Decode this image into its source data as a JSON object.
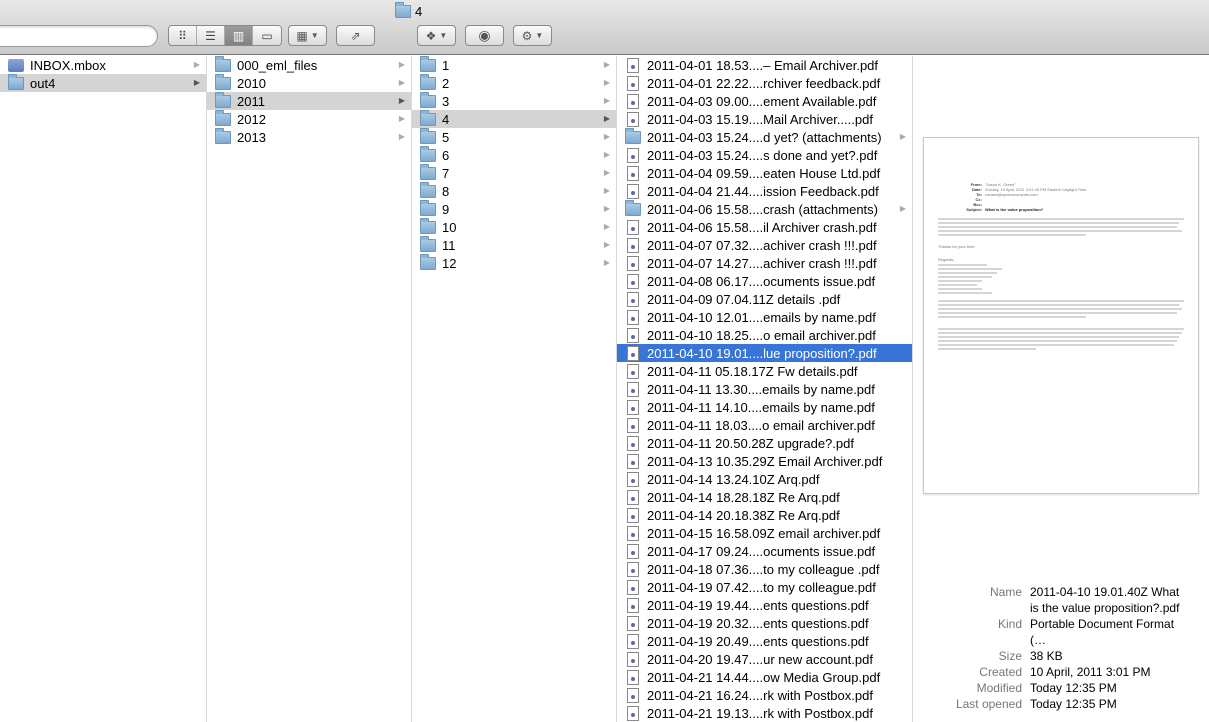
{
  "window": {
    "title": "4"
  },
  "toolbar": {
    "search_placeholder": "",
    "view_modes": [
      {
        "name": "icon-view",
        "glyph": "⠿"
      },
      {
        "name": "list-view",
        "glyph": "☰"
      },
      {
        "name": "column-view",
        "glyph": "▥"
      },
      {
        "name": "coverflow-view",
        "glyph": "▭"
      }
    ],
    "active_view": "column-view"
  },
  "columns": [
    {
      "items": [
        {
          "label": "INBOX.mbox",
          "kind": "mbox"
        },
        {
          "label": "out4",
          "kind": "folder",
          "selected": true
        }
      ]
    },
    {
      "items": [
        {
          "label": "000_eml_files",
          "kind": "folder"
        },
        {
          "label": "2010",
          "kind": "folder"
        },
        {
          "label": "2011",
          "kind": "folder",
          "selected": true
        },
        {
          "label": "2012",
          "kind": "folder"
        },
        {
          "label": "2013",
          "kind": "folder"
        }
      ]
    },
    {
      "items": [
        {
          "label": "1",
          "kind": "folder"
        },
        {
          "label": "2",
          "kind": "folder"
        },
        {
          "label": "3",
          "kind": "folder"
        },
        {
          "label": "4",
          "kind": "folder",
          "selected": true
        },
        {
          "label": "5",
          "kind": "folder"
        },
        {
          "label": "6",
          "kind": "folder"
        },
        {
          "label": "7",
          "kind": "folder"
        },
        {
          "label": "8",
          "kind": "folder"
        },
        {
          "label": "9",
          "kind": "folder"
        },
        {
          "label": "10",
          "kind": "folder"
        },
        {
          "label": "11",
          "kind": "folder"
        },
        {
          "label": "12",
          "kind": "folder"
        }
      ]
    },
    {
      "items": [
        {
          "label": "2011-04-01 18.53....– Email Archiver.pdf",
          "kind": "pdf"
        },
        {
          "label": "2011-04-01 22.22....rchiver feedback.pdf",
          "kind": "pdf"
        },
        {
          "label": "2011-04-03 09.00....ement Available.pdf",
          "kind": "pdf"
        },
        {
          "label": "2011-04-03 15.19....Mail Archiver.....pdf",
          "kind": "pdf"
        },
        {
          "label": "2011-04-03 15.24....d yet? (attachments)",
          "kind": "folder"
        },
        {
          "label": "2011-04-03 15.24....s done and yet?.pdf",
          "kind": "pdf"
        },
        {
          "label": "2011-04-04 09.59....eaten House Ltd.pdf",
          "kind": "pdf"
        },
        {
          "label": "2011-04-04 21.44....ission Feedback.pdf",
          "kind": "pdf"
        },
        {
          "label": "2011-04-06 15.58....crash (attachments)",
          "kind": "folder"
        },
        {
          "label": "2011-04-06 15.58....il Archiver crash.pdf",
          "kind": "pdf"
        },
        {
          "label": "2011-04-07 07.32....achiver crash !!!.pdf",
          "kind": "pdf"
        },
        {
          "label": "2011-04-07 14.27....achiver crash !!!.pdf",
          "kind": "pdf"
        },
        {
          "label": "2011-04-08 06.17....ocuments issue.pdf",
          "kind": "pdf"
        },
        {
          "label": "2011-04-09 07.04.11Z  details .pdf",
          "kind": "pdf"
        },
        {
          "label": "2011-04-10 12.01....emails by name.pdf",
          "kind": "pdf"
        },
        {
          "label": "2011-04-10 18.25....o email archiver.pdf",
          "kind": "pdf"
        },
        {
          "label": "2011-04-10 19.01....lue proposition?.pdf",
          "kind": "pdf",
          "active": true
        },
        {
          "label": "2011-04-11 05.18.17Z  Fw  details.pdf",
          "kind": "pdf"
        },
        {
          "label": "2011-04-11 13.30....emails by name.pdf",
          "kind": "pdf"
        },
        {
          "label": "2011-04-11 14.10....emails by name.pdf",
          "kind": "pdf"
        },
        {
          "label": "2011-04-11 18.03....o email archiver.pdf",
          "kind": "pdf"
        },
        {
          "label": "2011-04-11 20.50.28Z  upgrade?.pdf",
          "kind": "pdf"
        },
        {
          "label": "2011-04-13 10.35.29Z  Email Archiver.pdf",
          "kind": "pdf"
        },
        {
          "label": "2011-04-14 13.24.10Z  Arq.pdf",
          "kind": "pdf"
        },
        {
          "label": "2011-04-14 18.28.18Z  Re  Arq.pdf",
          "kind": "pdf"
        },
        {
          "label": "2011-04-14 20.18.38Z  Re  Arq.pdf",
          "kind": "pdf"
        },
        {
          "label": "2011-04-15 16.58.09Z  email archiver.pdf",
          "kind": "pdf"
        },
        {
          "label": "2011-04-17 09.24....ocuments issue.pdf",
          "kind": "pdf"
        },
        {
          "label": "2011-04-18 07.36....to my colleague .pdf",
          "kind": "pdf"
        },
        {
          "label": "2011-04-19 07.42....to my colleague.pdf",
          "kind": "pdf"
        },
        {
          "label": "2011-04-19 19.44....ents questions.pdf",
          "kind": "pdf"
        },
        {
          "label": "2011-04-19 20.32....ents questions.pdf",
          "kind": "pdf"
        },
        {
          "label": "2011-04-19 20.49....ents questions.pdf",
          "kind": "pdf"
        },
        {
          "label": "2011-04-20 19.47....ur new account.pdf",
          "kind": "pdf"
        },
        {
          "label": "2011-04-21 14.44....ow Media Group.pdf",
          "kind": "pdf"
        },
        {
          "label": "2011-04-21 16.24....rk with Postbox.pdf",
          "kind": "pdf"
        },
        {
          "label": "2011-04-21 19.13....rk with Postbox.pdf",
          "kind": "pdf"
        }
      ]
    }
  ],
  "preview": {
    "headers": [
      {
        "k": "From:",
        "v": "\"Jason K. Green\""
      },
      {
        "k": "Date:",
        "v": "Sunday, 10 April, 2011 3:01:40 PM Eastern Daylight Time"
      },
      {
        "k": "To:",
        "v": "contact@spotdocuments.com"
      },
      {
        "k": "Cc:",
        "v": ""
      },
      {
        "k": "Bcc:",
        "v": ""
      },
      {
        "k": "Subject:",
        "v": "What is the value proposition?"
      }
    ],
    "thanks": "Thanks for your time.",
    "regards": "Regards,"
  },
  "info": {
    "rows": [
      {
        "k": "Name",
        "v": "2011-04-10 19.01.40Z  What is the value proposition?.pdf"
      },
      {
        "k": "Kind",
        "v": "Portable Document Format (…"
      },
      {
        "k": "Size",
        "v": "38 KB"
      },
      {
        "k": "Created",
        "v": "10 April, 2011 3:01 PM"
      },
      {
        "k": "Modified",
        "v": "Today 12:35 PM"
      },
      {
        "k": "Last opened",
        "v": "Today 12:35 PM"
      }
    ]
  }
}
